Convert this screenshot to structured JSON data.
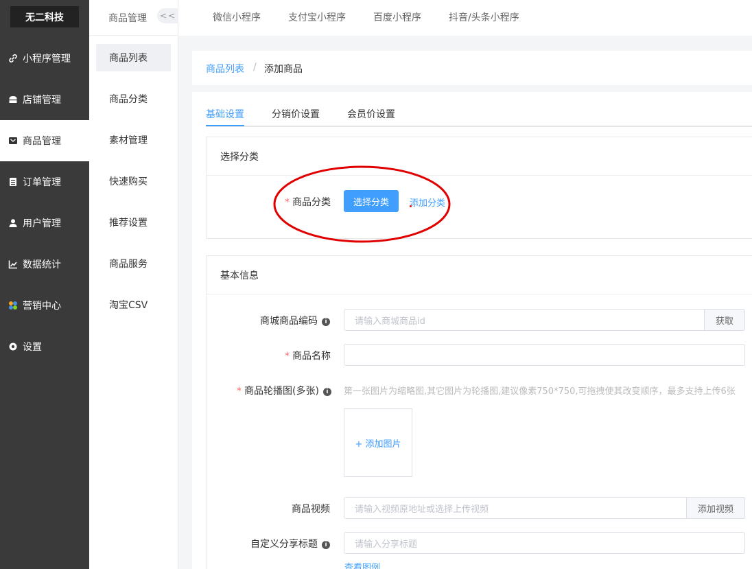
{
  "brand": "无二科技",
  "sidebar": {
    "items": [
      {
        "label": "小程序管理",
        "icon": "link-icon"
      },
      {
        "label": "店铺管理",
        "icon": "store-icon"
      },
      {
        "label": "商品管理",
        "icon": "goods-icon"
      },
      {
        "label": "订单管理",
        "icon": "order-icon"
      },
      {
        "label": "用户管理",
        "icon": "user-icon"
      },
      {
        "label": "数据统计",
        "icon": "chart-icon"
      },
      {
        "label": "营销中心",
        "icon": "marketing-icon"
      },
      {
        "label": "设置",
        "icon": "gear-icon"
      }
    ],
    "active_index": 2
  },
  "subsidebar": {
    "title": "商品管理",
    "collapse_label": "<<",
    "items": [
      "商品列表",
      "商品分类",
      "素材管理",
      "快速购买",
      "推荐设置",
      "商品服务",
      "淘宝CSV"
    ],
    "active_index": 0
  },
  "topbar": {
    "tabs": [
      "微信小程序",
      "支付宝小程序",
      "百度小程序",
      "抖音/头条小程序"
    ]
  },
  "breadcrumb": {
    "parent": "商品列表",
    "separator": "/",
    "current": "添加商品"
  },
  "tabs": {
    "items": [
      "基础设置",
      "分销价设置",
      "会员价设置"
    ],
    "active_index": 0
  },
  "category_card": {
    "title": "选择分类",
    "field_label": "商品分类",
    "select_button": "选择分类",
    "add_link": "添加分类"
  },
  "basic_card": {
    "title": "基本信息",
    "sku_code": {
      "label": "商城商品编码",
      "placeholder": "请输入商城商品id",
      "append": "获取"
    },
    "name": {
      "label": "商品名称",
      "value": ""
    },
    "carousel": {
      "label": "商品轮播图(多张)",
      "hint": "第一张图片为缩略图,其它图片为轮播图,建议像素750*750,可拖拽使其改变顺序，最多支持上传6张",
      "upload_label": "+ 添加图片"
    },
    "video": {
      "label": "商品视频",
      "placeholder": "请输入视频原地址或选择上传视频",
      "append": "添加视频"
    },
    "share_title": {
      "label": "自定义分享标题",
      "placeholder": "请输入分享标题",
      "example_link": "查看图例"
    }
  },
  "colors": {
    "accent": "#409eff",
    "sidebar_bg": "#3a3a3a",
    "required": "#f56c6c",
    "annotation": "#e00000"
  }
}
